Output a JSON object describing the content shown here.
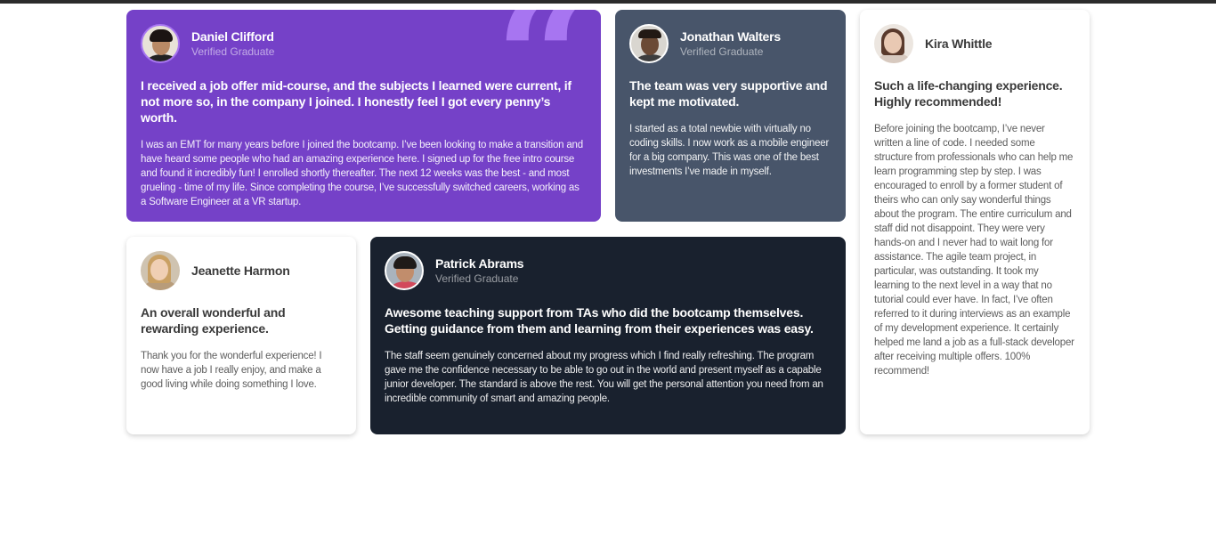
{
  "testimonials": [
    {
      "name": "Daniel Clifford",
      "role": "Verified Graduate",
      "headline": "I received a job offer mid-course, and the subjects I learned were current, if not more so, in the company I joined. I honestly feel I got every penny’s worth.",
      "body": "I was an EMT for many years before I joined the bootcamp. I’ve been looking to make a transition and have heard some people who had an amazing experience here. I signed up for the free intro course and found it incredibly fun! I enrolled shortly thereafter. The next 12 weeks was the best - and most grueling - time of my life. Since completing the course, I’ve successfully switched careers, working as a Software Engineer at a VR startup.",
      "quote_glyph": "“"
    },
    {
      "name": "Jonathan Walters",
      "role": "Verified Graduate",
      "headline": "The team was very supportive and kept me motivated.",
      "body": "I started as a total newbie with virtually no coding skills. I now work as a mobile engineer for a big company. This was one of the best investments I’ve made in myself."
    },
    {
      "name": "Kira Whittle",
      "role": "",
      "headline": "Such a life-changing experience. Highly recommended!",
      "body": "Before joining the bootcamp, I’ve never written a line of code. I needed some structure from professionals who can help me learn programming step by step. I was encouraged to enroll by a former student of theirs who can only say wonderful things about the program. The entire curriculum and staff did not disappoint. They were very hands-on and I never had to wait long for assistance. The agile team project, in particular, was outstanding. It took my learning to the next level in a way that no tutorial could ever have. In fact, I’ve often referred to it during interviews as an example of my development experience. It certainly helped me land a job as a full-stack developer after receiving multiple offers. 100% recommend!"
    },
    {
      "name": "Jeanette Harmon",
      "role": "",
      "headline": "An overall wonderful and rewarding experience.",
      "body": "Thank you for the wonderful experience! I now have a job I really enjoy, and make a good living while doing something I love."
    },
    {
      "name": "Patrick Abrams",
      "role": "Verified Graduate",
      "headline": "Awesome teaching support from TAs who did the bootcamp themselves. Getting guidance from them and learning from their experiences was easy.",
      "body": "The staff seem genuinely concerned about my progress which I find really refreshing. The program gave me the confidence necessary to be able to go out in the world and present myself as a capable junior developer. The standard is above the rest. You will get the personal attention you need from an incredible community of smart and amazing people."
    }
  ],
  "colors": {
    "purple": "#7541c8",
    "grayblue": "#48556a",
    "darkblue": "#19212e",
    "white": "#ffffff",
    "quote": "#a775f1"
  }
}
